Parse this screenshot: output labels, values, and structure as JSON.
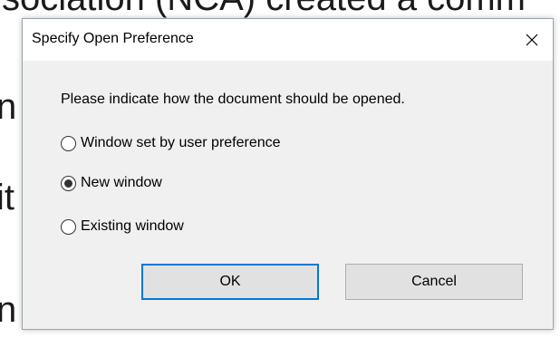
{
  "background": {
    "lines": [
      "sociation (NCA) created a comm",
      "n",
      "it",
      "n"
    ]
  },
  "dialog": {
    "title": "Specify Open Preference",
    "close_icon": "close-icon",
    "prompt": "Please indicate how the document should be opened.",
    "options": [
      {
        "label": "Window set by user preference",
        "selected": false
      },
      {
        "label": "New window",
        "selected": true
      },
      {
        "label": "Existing window",
        "selected": false
      }
    ],
    "ok_label": "OK",
    "cancel_label": "Cancel"
  },
  "colors": {
    "dialog_bg": "#f0f0f0",
    "titlebar_bg": "#ffffff",
    "default_button_border": "#0078d7",
    "button_bg": "#e1e1e1"
  }
}
